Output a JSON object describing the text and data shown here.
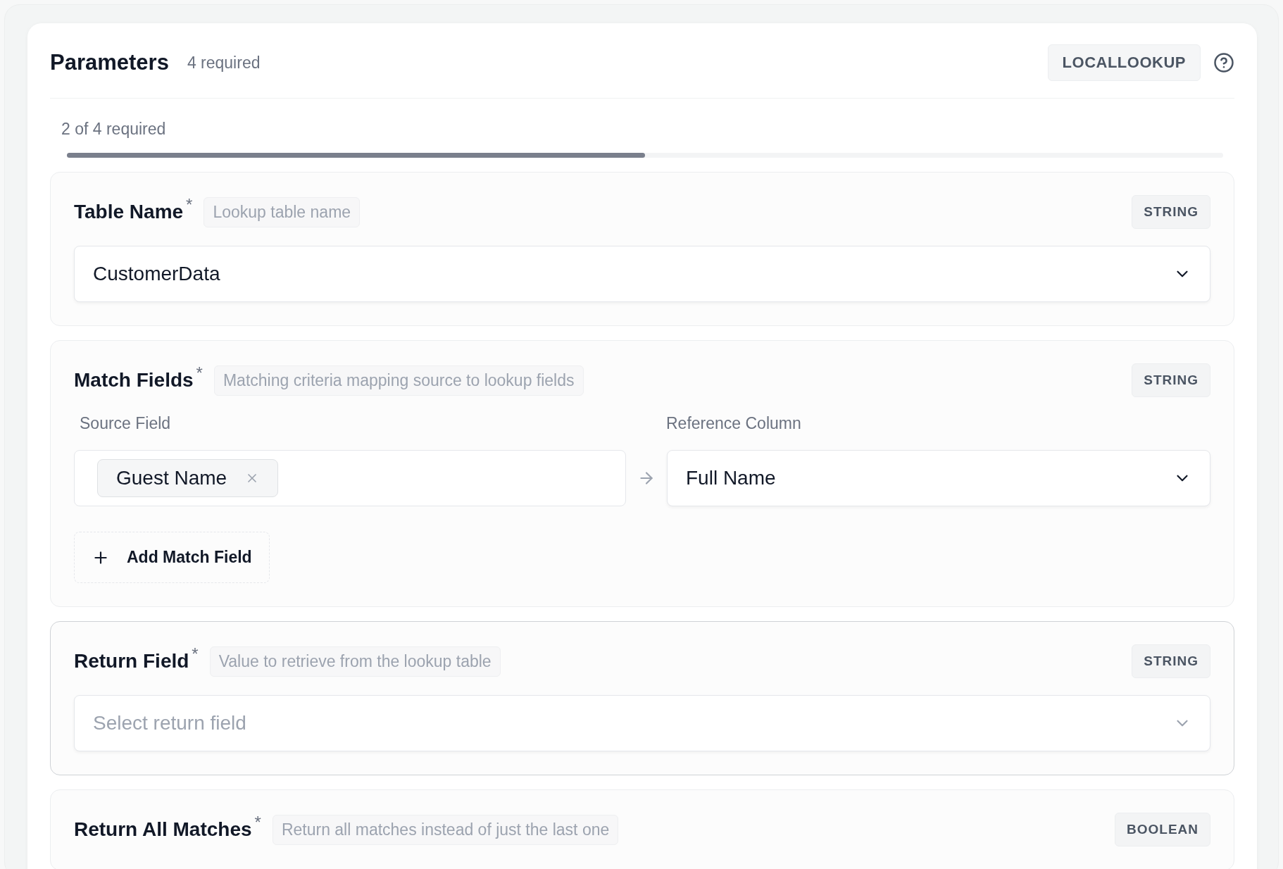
{
  "header": {
    "title": "Parameters",
    "required_count": "4 required",
    "type_badge": "LOCALLOOKUP"
  },
  "progress": {
    "label": "2 of 4 required",
    "level": 0.5
  },
  "parameters": [
    {
      "kind": "select",
      "label": "Table Name",
      "required_mark": "*",
      "hint": "Lookup table name",
      "type": "STRING",
      "focused": false,
      "value": "CustomerData"
    },
    {
      "kind": "mapping",
      "label": "Match Fields",
      "required_mark": "*",
      "hint": "Matching criteria mapping source to lookup fields",
      "type": "STRING",
      "focused": false,
      "source_label": "Source Field",
      "reference_label": "Reference Column",
      "source_tags": [
        "Guest Name"
      ],
      "reference_value": "Full Name",
      "add_button": "Add Match Field"
    },
    {
      "kind": "select",
      "label": "Return Field",
      "required_mark": "*",
      "hint": "Value to retrieve from the lookup table",
      "type": "STRING",
      "focused": true,
      "placeholder": "Select return field"
    },
    {
      "kind": "boolean",
      "label": "Return All Matches",
      "required_mark": "*",
      "hint": "Return all matches instead of just the last one",
      "type": "BOOLEAN",
      "focused": false
    }
  ]
}
